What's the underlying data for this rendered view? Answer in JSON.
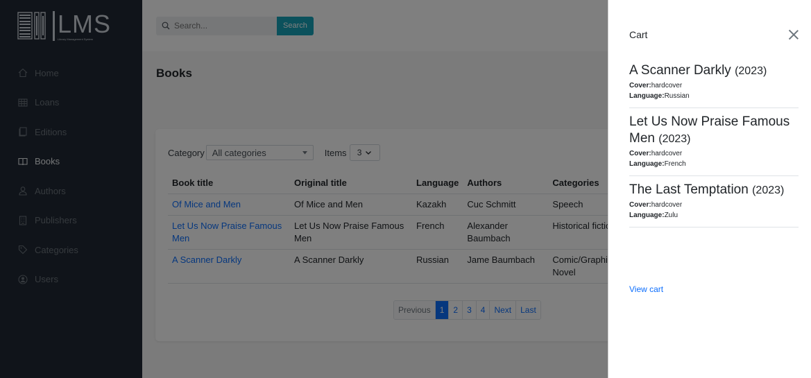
{
  "brand": {
    "name": "LMS",
    "tagline": "Library Management System"
  },
  "sidebar": {
    "items": [
      {
        "label": "Home",
        "icon": "home-icon",
        "active": false
      },
      {
        "label": "Loans",
        "icon": "table-icon",
        "active": false
      },
      {
        "label": "Editions",
        "icon": "copy-icon",
        "active": false
      },
      {
        "label": "Books",
        "icon": "book-icon",
        "active": true
      },
      {
        "label": "Authors",
        "icon": "user-icon",
        "active": false
      },
      {
        "label": "Publishers",
        "icon": "building-icon",
        "active": false
      },
      {
        "label": "Categories",
        "icon": "tag-icon",
        "active": false
      },
      {
        "label": "Users",
        "icon": "user-circle-icon",
        "active": false
      }
    ]
  },
  "search": {
    "placeholder": "Search...",
    "button": "Search"
  },
  "page": {
    "title": "Books"
  },
  "filters": {
    "category_label": "Category",
    "category_value": "All categories",
    "items_label": "Items",
    "items_value": "3"
  },
  "table": {
    "headers": [
      "Book title",
      "Original title",
      "Language",
      "Authors",
      "Categories"
    ],
    "rows": [
      [
        "Of Mice and Men",
        "Of Mice and Men",
        "Kazakh",
        "Cuc Schmitt",
        "Speech"
      ],
      [
        "Let Us Now Praise Famous Men",
        "Let Us Now Praise Famous Men",
        "French",
        "Alexander Baumbach",
        "Historical fictio"
      ],
      [
        "A Scanner Darkly",
        "A Scanner Darkly",
        "Russian",
        "Jame Baumbach",
        "Comic/Graphic Novel"
      ]
    ]
  },
  "pagination": {
    "previous": "Previous",
    "pages": [
      "1",
      "2",
      "3",
      "4"
    ],
    "next": "Next",
    "last": "Last",
    "current": "1"
  },
  "cart": {
    "title": "Cart",
    "cover_label": "Cover:",
    "language_label": "Language:",
    "items": [
      {
        "title": "A Scanner Darkly",
        "year": "(2023)",
        "cover": "hardcover",
        "language": "Russian"
      },
      {
        "title": "Let Us Now Praise Famous Men",
        "year": "(2023)",
        "cover": "hardcover",
        "language": "French"
      },
      {
        "title": "The Last Temptation",
        "year": "(2023)",
        "cover": "hardcover",
        "language": "Zulu"
      }
    ],
    "view_cart": "View cart"
  },
  "colors": {
    "sidebar_bg": "#212934",
    "accent": "#0d6efd",
    "search_button": "#17a2b8"
  }
}
